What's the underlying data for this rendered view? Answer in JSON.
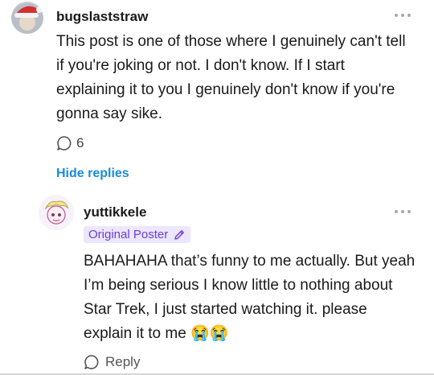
{
  "comment": {
    "username": "bugslaststraw",
    "text": "This post is one of those where I genuinely can't tell if you're joking or not. I don't know. If I start explaining it to you I genuinely don't know if you're gonna say sike.",
    "reply_count": "6",
    "hide_replies_label": "Hide replies"
  },
  "reply": {
    "username": "yuttikkele",
    "badge_label": "Original Poster",
    "text": "BAHAHAHA that’s funny to me actually. But yeah I’m being serious I know little to nothing about Star Trek, I just started watching it. please explain it to me 😭😭",
    "reply_label": "Reply"
  },
  "colors": {
    "link": "#1a8cd8",
    "badge_bg": "#ece6ff",
    "badge_text": "#6b3fd4"
  },
  "icons": [
    "speech-bubble-icon",
    "pencil-icon",
    "more-dots-icon",
    "santa-hat-icon"
  ]
}
